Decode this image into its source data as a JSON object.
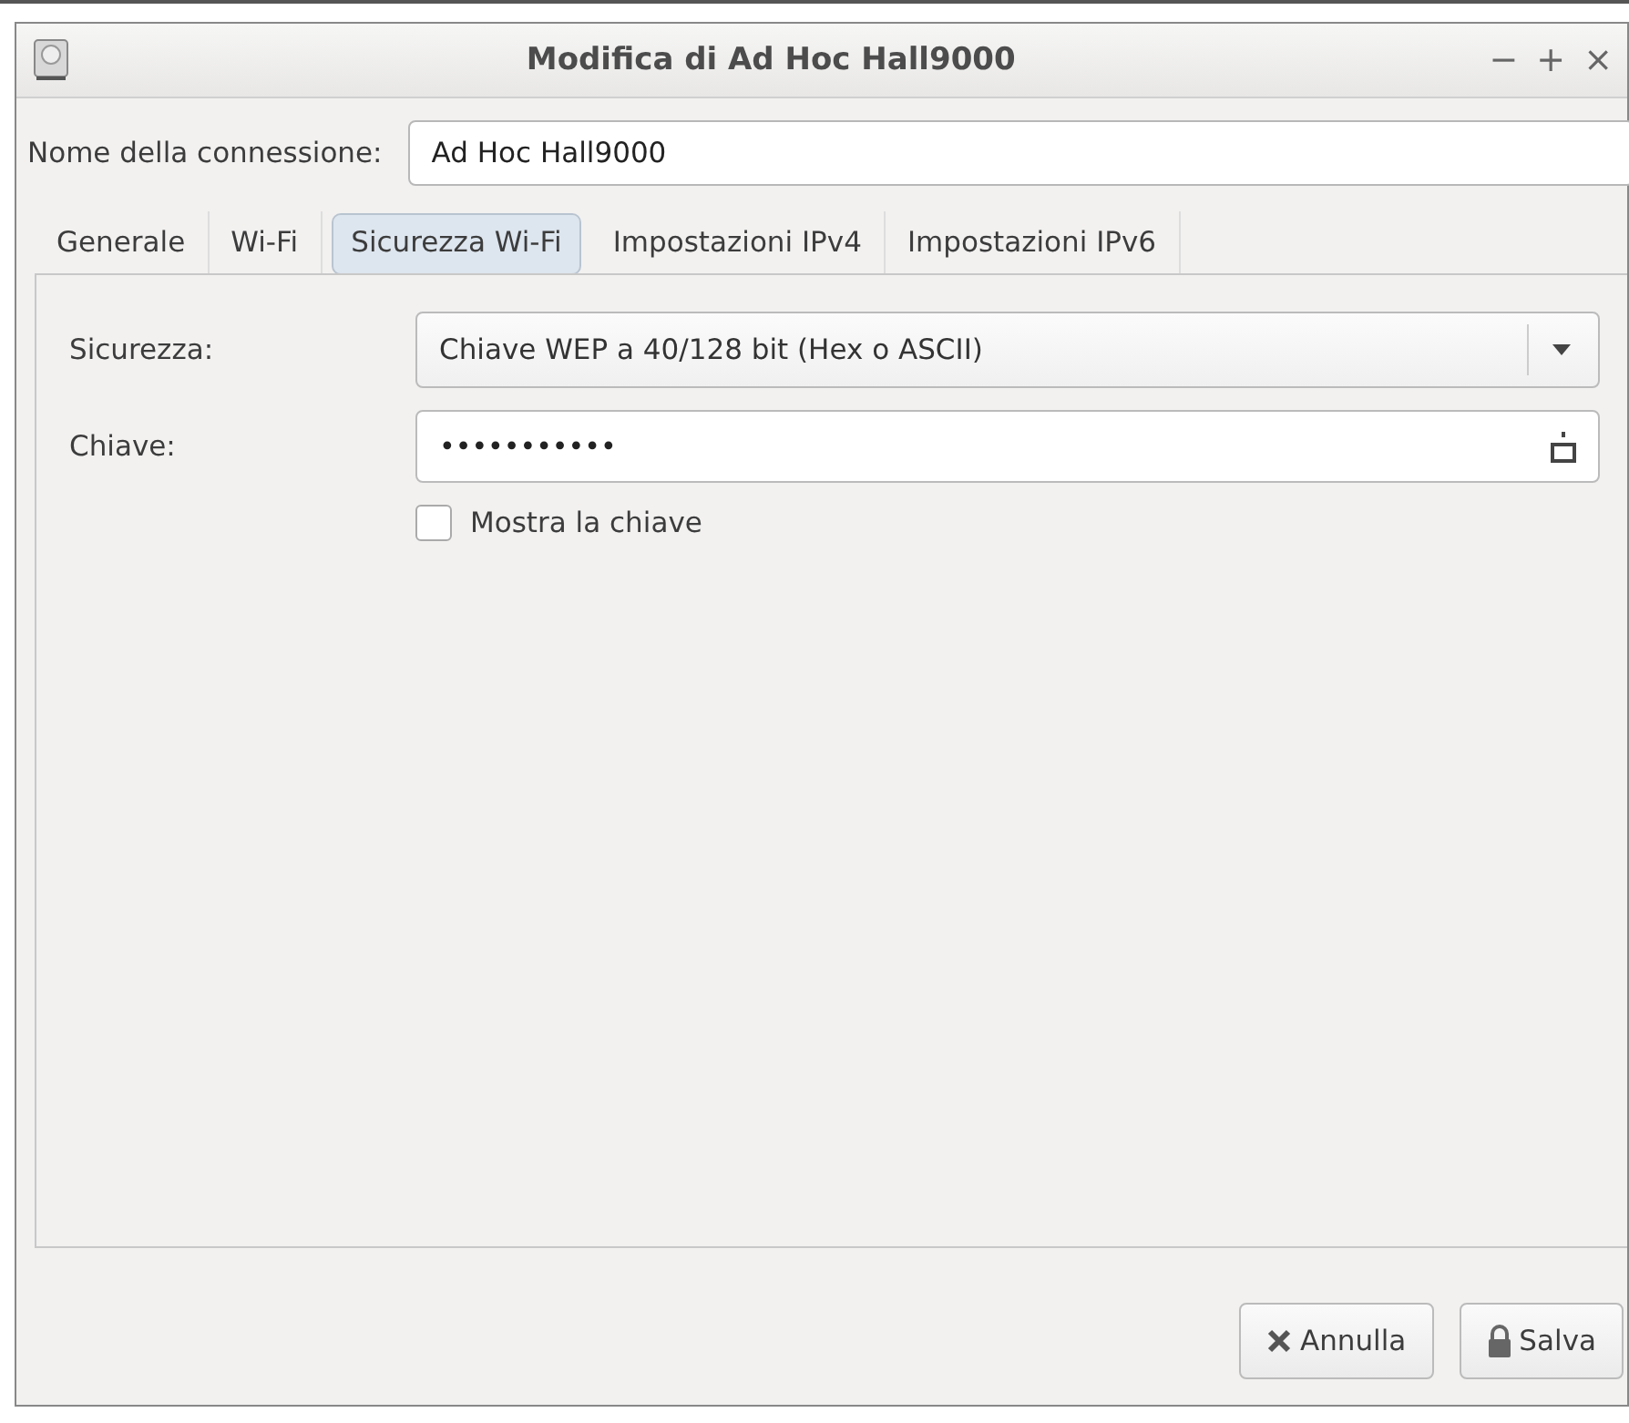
{
  "window": {
    "title": "Modifica di Ad Hoc Hall9000",
    "controls": [
      "−",
      "+",
      "×"
    ]
  },
  "connection_name": {
    "label": "Nome della connessione:",
    "value": "Ad Hoc Hall9000"
  },
  "tabs": [
    {
      "label": "Generale",
      "selected": false
    },
    {
      "label": "Wi-Fi",
      "selected": false
    },
    {
      "label": "Sicurezza Wi-Fi",
      "selected": true
    },
    {
      "label": "Impostazioni IPv4",
      "selected": false
    },
    {
      "label": "Impostazioni IPv6",
      "selected": false
    }
  ],
  "security": {
    "label": "Sicurezza:",
    "value": "Chiave WEP a 40/128 bit (Hex o ASCII)"
  },
  "key": {
    "label": "Chiave:",
    "value": "•••••••••••"
  },
  "show_key": {
    "label": "Mostra la chiave",
    "checked": false
  },
  "buttons": [
    {
      "kind": "cancel",
      "label": "Annulla"
    },
    {
      "kind": "save",
      "label": "Salva"
    }
  ]
}
